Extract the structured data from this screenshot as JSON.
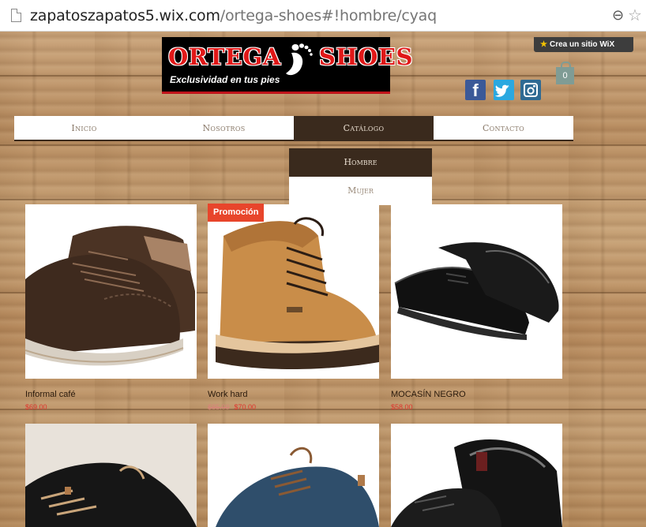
{
  "browser": {
    "url_domain": "zapatoszapatos5.wix.com",
    "url_path": "/ortega-shoes#!hombre/cyaq",
    "zoom_glyph": "⊖",
    "star_glyph": "☆"
  },
  "logo": {
    "title_left": "ORTEGA",
    "title_right": "SHOES",
    "tagline": "Exclusividad en tus pies"
  },
  "wix_banner": {
    "label": "Crea un sitio WiX"
  },
  "social": {
    "facebook": "f",
    "twitter": "t",
    "instagram": "◙"
  },
  "cart": {
    "count": "0"
  },
  "nav": {
    "items": [
      "Inicio",
      "Nosotros",
      "Catálogo",
      "Contacto"
    ],
    "active": "Catálogo"
  },
  "submenu": {
    "items": [
      "Hombre",
      "Mujer"
    ],
    "active": "Hombre"
  },
  "products": [
    {
      "name": "Informal café",
      "price": "$69.00",
      "old_price": ""
    },
    {
      "name": "Work hard",
      "price": "$70.00",
      "old_price": "$85.00",
      "badge": "Promoción"
    },
    {
      "name": "MOCASÍN NEGRO",
      "price": "$58.00",
      "old_price": ""
    }
  ],
  "colors": {
    "nav_active": "#3a2a1d",
    "promo": "#e8452b",
    "price": "#e0342d",
    "logo_red": "#e01818"
  }
}
